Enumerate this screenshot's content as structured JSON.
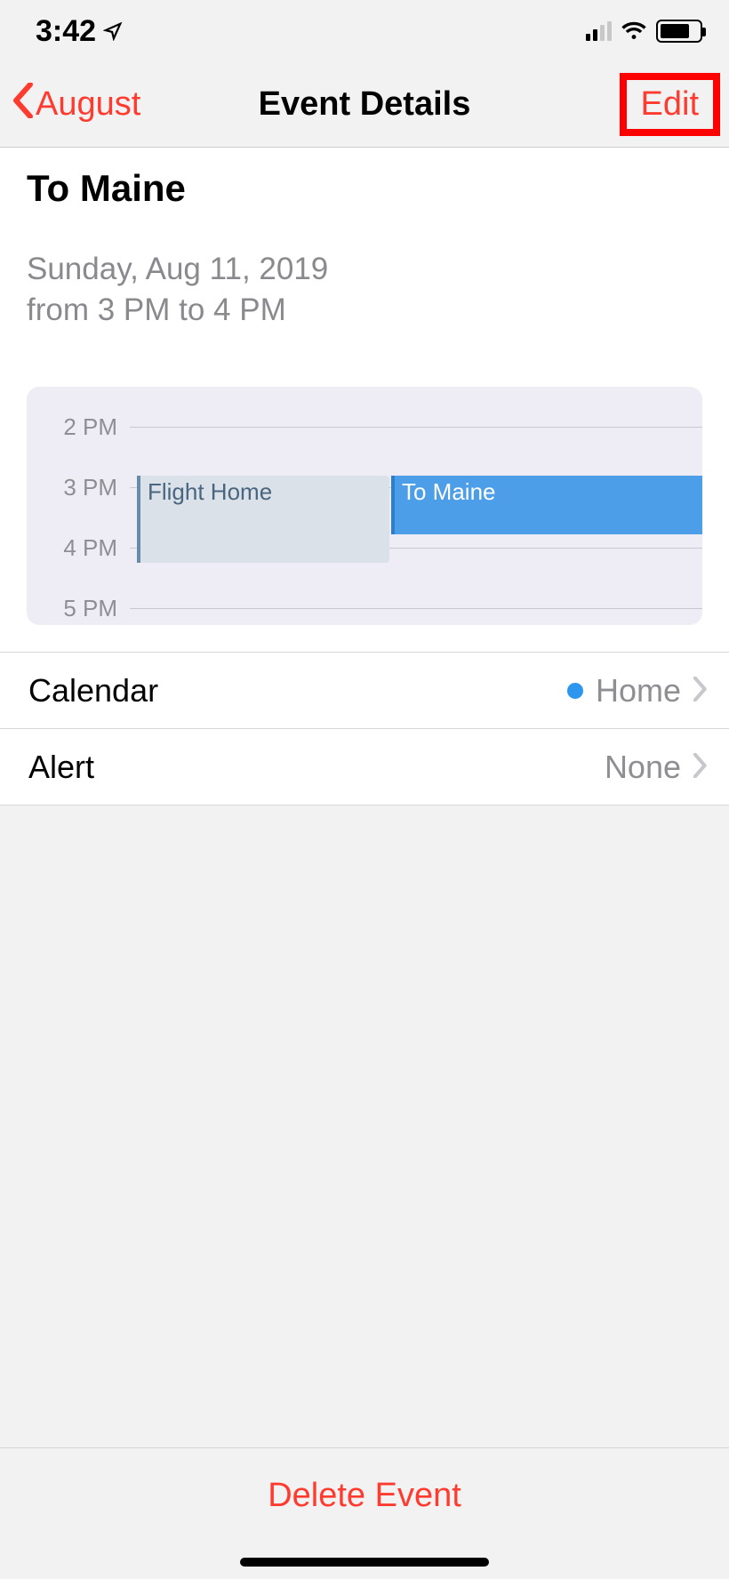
{
  "status": {
    "time": "3:42"
  },
  "nav": {
    "back_label": "August",
    "title": "Event Details",
    "edit_label": "Edit"
  },
  "event": {
    "title": "To Maine",
    "date_line": "Sunday, Aug 11, 2019",
    "time_line": "from 3 PM to 4 PM"
  },
  "timeline": {
    "hours": [
      "2 PM",
      "3 PM",
      "4 PM",
      "5 PM"
    ],
    "events": [
      {
        "title": "Flight Home"
      },
      {
        "title": "To Maine"
      }
    ]
  },
  "options": {
    "calendar": {
      "label": "Calendar",
      "value": "Home"
    },
    "alert": {
      "label": "Alert",
      "value": "None"
    }
  },
  "footer": {
    "delete_label": "Delete Event"
  }
}
